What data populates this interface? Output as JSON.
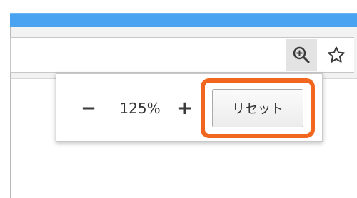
{
  "toolbar": {
    "zoom_icon": "zoom-in-magnifier-icon",
    "star_icon": "bookmark-star-icon"
  },
  "zoom_bubble": {
    "minus_label": "−",
    "level": "125%",
    "plus_label": "+",
    "reset_label": "リセット"
  },
  "colors": {
    "titlebar": "#4aa3f0",
    "highlight": "#f2671f",
    "toolbar_bg": "#f2f2f2"
  }
}
